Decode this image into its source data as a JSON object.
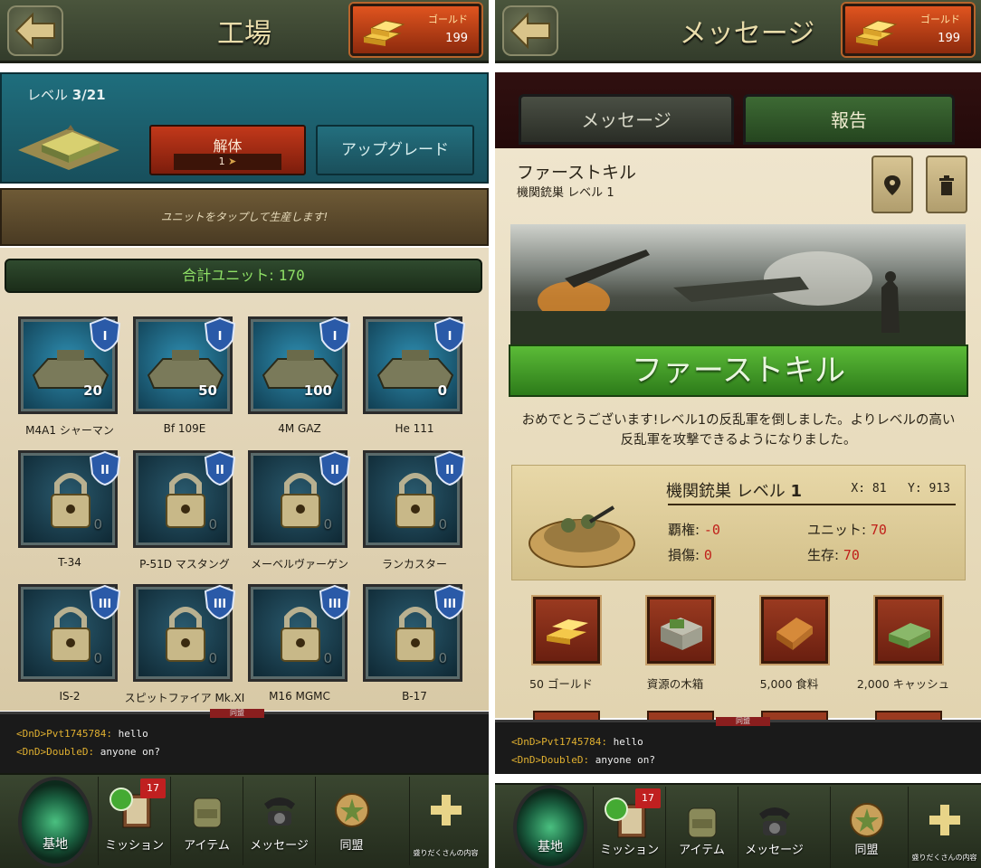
{
  "factory": {
    "title": "工場",
    "gold_label": "ゴールド",
    "gold_value": "199",
    "level_label": "レベル",
    "level_value": "3/21",
    "dismantle_label": "解体",
    "dismantle_cost": "1",
    "upgrade_label": "アップグレード",
    "hint": "ユニットをタップして生産します!",
    "total_units_label": "合計ユニット:",
    "total_units_value": "170",
    "units": [
      {
        "name": "M4A1 シャーマン",
        "count": "20",
        "tier": "I",
        "locked": false
      },
      {
        "name": "Bf 109E",
        "count": "50",
        "tier": "I",
        "locked": false
      },
      {
        "name": "4M GAZ",
        "count": "100",
        "tier": "I",
        "locked": false
      },
      {
        "name": "He 111",
        "count": "0",
        "tier": "I",
        "locked": false
      },
      {
        "name": "T-34",
        "count": "0",
        "tier": "II",
        "locked": true
      },
      {
        "name": "P-51D マスタング",
        "count": "0",
        "tier": "II",
        "locked": true
      },
      {
        "name": "メーベルヴァーゲン",
        "count": "0",
        "tier": "II",
        "locked": true
      },
      {
        "name": "ランカスター",
        "count": "0",
        "tier": "II",
        "locked": true
      },
      {
        "name": "IS-2",
        "count": "0",
        "tier": "III",
        "locked": true
      },
      {
        "name": "スピットファイア Mk.XI",
        "count": "0",
        "tier": "III",
        "locked": true
      },
      {
        "name": "M16 MGMC",
        "count": "0",
        "tier": "III",
        "locked": true
      },
      {
        "name": "B-17",
        "count": "0",
        "tier": "III",
        "locked": true
      }
    ]
  },
  "chat": {
    "tab": "同盟",
    "lines": [
      {
        "tag": "<DnD>Pvt1745784:",
        "text": "hello"
      },
      {
        "tag": "<DnD>DoubleD:",
        "text": "anyone on?"
      }
    ]
  },
  "nav": {
    "base": "基地",
    "missions": "ミッション",
    "missions_badge": "17",
    "items": "アイテム",
    "messages": "メッセージ",
    "alliance": "同盟",
    "more": "盛りだくさんの内容"
  },
  "messages": {
    "title": "メッセージ",
    "gold_label": "ゴールド",
    "gold_value": "199",
    "tab_messages": "メッセージ",
    "tab_reports": "報告",
    "report_title": "ファーストキル",
    "report_sub_name": "機関銃巣",
    "report_sub_level_label": "レベル",
    "report_sub_level": "1",
    "banner": "ファーストキル",
    "congrats": "おめでとうございます!レベル1の反乱軍を倒しました。よりレベルの高い反乱軍を攻撃できるようになりました。",
    "target_name": "機関銃巣",
    "target_level_label": "レベル",
    "target_level": "1",
    "x_label": "X:",
    "x_value": "81",
    "y_label": "Y:",
    "y_value": "913",
    "dominance_label": "覇権:",
    "dominance_value": "-0",
    "units_label": "ユニット:",
    "units_value": "70",
    "damage_label": "損傷:",
    "damage_value": "0",
    "survived_label": "生存:",
    "survived_value": "70",
    "rewards": [
      {
        "label": "50 ゴールド"
      },
      {
        "label": "資源の木箱"
      },
      {
        "label": "5,000 食料"
      },
      {
        "label": "2,000 キャッシュ"
      }
    ]
  }
}
